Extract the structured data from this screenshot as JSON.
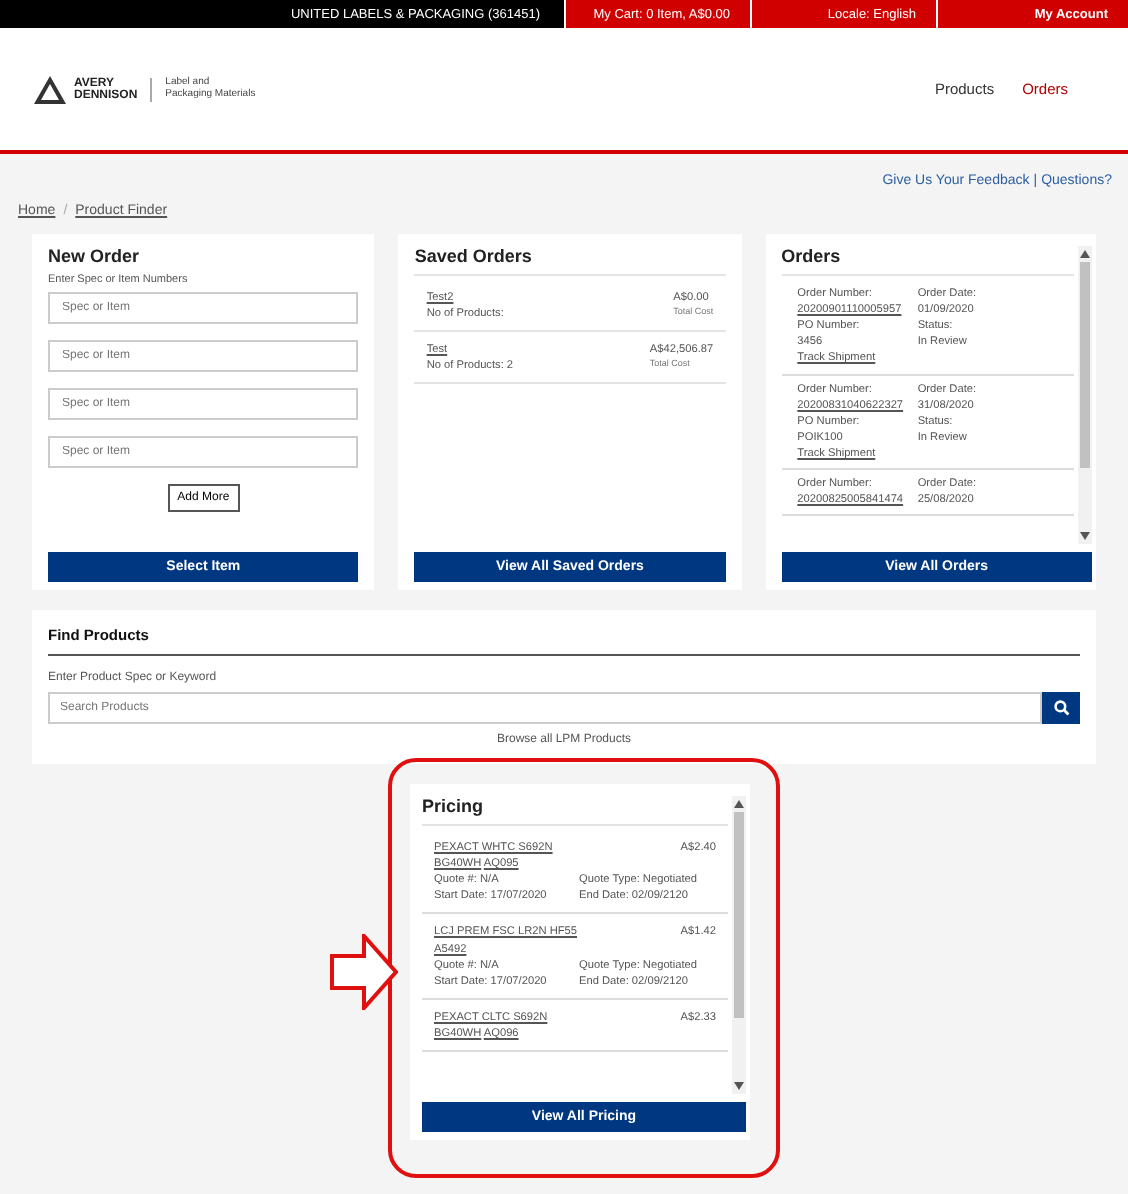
{
  "top_bar": {
    "account": "UNITED LABELS & PACKAGING (361451)",
    "cart": "My Cart: 0 Item,  A$0.00",
    "locale": "Locale: English",
    "my_account": "My Account"
  },
  "header": {
    "logo_words": [
      "AVERY",
      "DENNISON"
    ],
    "tagline": [
      "Label and",
      "Packaging Materials"
    ],
    "nav": [
      {
        "label": "Products",
        "selected": false
      },
      {
        "label": "Orders",
        "selected": true
      }
    ]
  },
  "help_links": {
    "feedback": "Give Us Your Feedback",
    "separator": "|",
    "questions": "Questions?"
  },
  "breadcrumb": {
    "items": [
      "Home",
      "Product Finder"
    ],
    "separator": "/"
  },
  "new_order": {
    "title": "New Order",
    "hint": "Enter Spec or Item Numbers",
    "fields": [
      {
        "placeholder": "Spec or Item"
      },
      {
        "placeholder": "Spec or Item"
      },
      {
        "placeholder": "Spec or Item"
      },
      {
        "placeholder": "Spec or Item"
      }
    ],
    "add_more": "Add More",
    "submit": "Select Item"
  },
  "saved_orders": {
    "title": "Saved Orders",
    "items": [
      {
        "name": "Test2",
        "products": "No of Products:",
        "cost": "A$0.00",
        "cost_label": "Total Cost"
      },
      {
        "name": "Test",
        "products": "No of Products: 2",
        "cost": "A$42,506.87",
        "cost_label": "Total Cost"
      }
    ],
    "button": "View All Saved Orders"
  },
  "orders": {
    "title": "Orders",
    "items": [
      {
        "number_label": "Order Number:",
        "number": "20200901110005957",
        "date_label": "Order Date:",
        "date": "01/09/2020",
        "po_label": "PO Number:",
        "po": "3456",
        "status_label": "Status:",
        "status": "In Review",
        "track": "Track Shipment"
      },
      {
        "number_label": "Order Number:",
        "number": "20200831040622327",
        "date_label": "Order Date:",
        "date": "31/08/2020",
        "po_label": "PO Number:",
        "po": "POIK100",
        "status_label": "Status:",
        "status": "In Review",
        "track": "Track Shipment"
      },
      {
        "number_label": "Order Number:",
        "number": "20200825005841474",
        "date_label": "Order Date:",
        "date": "25/08/2020"
      }
    ],
    "button": "View All Orders"
  },
  "find_products": {
    "title": "Find Products",
    "hint": "Enter Product Spec or Keyword",
    "search": {
      "placeholder": "Search Products"
    },
    "browse": "Browse all LPM Products"
  },
  "pricing": {
    "title": "Pricing",
    "items": [
      {
        "name": "PEXACT WHTC S692N BG40WH",
        "code": "AQ095",
        "price": "A$2.40",
        "quote": "Quote #: N/A",
        "quote_type": "Quote Type: Negotiated",
        "start": "Start Date: 17/07/2020",
        "end": "End Date: 02/09/2120"
      },
      {
        "name": "LCJ PREM FSC LR2N HF55",
        "code": "A5492",
        "price": "A$1.42",
        "quote": "Quote #: N/A",
        "quote_type": "Quote Type: Negotiated",
        "start": "Start Date: 17/07/2020",
        "end": "End Date: 02/09/2120"
      },
      {
        "name": "PEXACT CLTC S692N BG40WH",
        "code": "AQ096",
        "price": "A$2.33"
      }
    ],
    "button": "View All Pricing"
  }
}
